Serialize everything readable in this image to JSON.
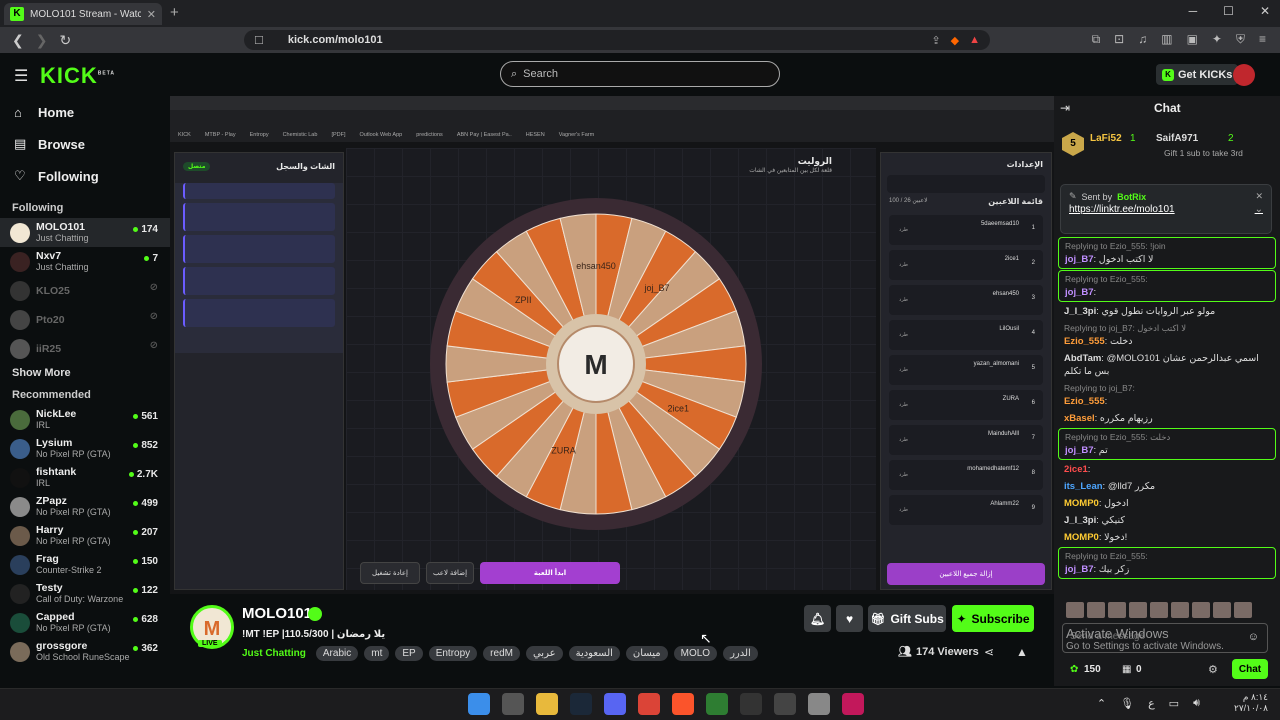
{
  "browser": {
    "tab_title": "MOLO101 Stream - Watch Li...",
    "tab_close": "✕",
    "new_tab": "+",
    "url": "kick.com/molo101"
  },
  "header": {
    "logo": "KICK",
    "logo_badge": "BETA",
    "search_placeholder": "Search",
    "get_kicks": "Get KICKs"
  },
  "sidebar": {
    "nav": [
      {
        "label": "Home",
        "icon": "home-icon"
      },
      {
        "label": "Browse",
        "icon": "browse-icon"
      },
      {
        "label": "Following",
        "icon": "heart-icon"
      }
    ],
    "following_title": "Following",
    "following": [
      {
        "name": "MOLO101",
        "category": "Just Chatting",
        "viewers": "174",
        "live": true,
        "avatar": "#f1e7d4"
      },
      {
        "name": "Nxv7",
        "category": "Just Chatting",
        "viewers": "7",
        "live": true,
        "avatar": "#3a2222"
      },
      {
        "name": "KLO25",
        "category": "",
        "viewers": "",
        "live": false,
        "avatar": "#333"
      },
      {
        "name": "Pto20",
        "category": "",
        "viewers": "",
        "live": false,
        "avatar": "#444"
      },
      {
        "name": "iiR25",
        "category": "",
        "viewers": "",
        "live": false,
        "avatar": "#555"
      }
    ],
    "show_more": "Show More",
    "recommended_title": "Recommended",
    "recommended": [
      {
        "name": "NickLee",
        "category": "IRL",
        "viewers": "561",
        "avatar": "#4a6b3c"
      },
      {
        "name": "Lysium",
        "category": "No Pixel RP (GTA)",
        "viewers": "852",
        "avatar": "#3a5d8a"
      },
      {
        "name": "fishtank",
        "category": "IRL",
        "viewers": "2.7K",
        "avatar": "#111"
      },
      {
        "name": "ZPapz",
        "category": "No Pixel RP (GTA)",
        "viewers": "499",
        "avatar": "#8a8a8a"
      },
      {
        "name": "Harry",
        "category": "No Pixel RP (GTA)",
        "viewers": "207",
        "avatar": "#6b5a4a"
      },
      {
        "name": "Frag",
        "category": "Counter-Strike 2",
        "viewers": "150",
        "avatar": "#2a3f5c"
      },
      {
        "name": "Testy",
        "category": "Call of Duty: Warzone",
        "viewers": "122",
        "avatar": "#222"
      },
      {
        "name": "Capped",
        "category": "No Pixel RP (GTA)",
        "viewers": "628",
        "avatar": "#1a4d3a"
      },
      {
        "name": "grossgore",
        "category": "Old School RuneScape",
        "viewers": "362",
        "avatar": "#7a6b5a"
      }
    ]
  },
  "stream": {
    "roulette_title": "الروليت",
    "roulette_subtitle": "قلعة لكل بين المتابعين في الشات",
    "settings_title": "الإعدادات",
    "chat_log_title": "الشات والسجل",
    "players_list_title": "قائمة اللاعبين",
    "players_count": "100 / 26 لاعبين",
    "players": [
      "5daeemsad10",
      "2ice1",
      "ehsan450",
      "LilOusil",
      "yazan_almomani",
      "ZURA",
      "MainduhAlll",
      "mohamedhatemf12",
      "Ahlamm22"
    ],
    "player_status": "طرد",
    "start_game": "ابدأ اللعبة",
    "add_player": "إضافة لاعب",
    "restart": "إعادة تشغيل",
    "remove_all": "إزالة جميع اللاعبين",
    "wheel_labels": [
      "joj_B7",
      "2ice1",
      "ZURA",
      "ZPII",
      "ehsan450"
    ]
  },
  "channel": {
    "name": "MOLO101",
    "live_label": "LIVE",
    "title": "!MT !EP |110.5/300 | يلا رمضان",
    "category": "Just Chatting",
    "tags": [
      "Arabic",
      "mt",
      "EP",
      "Entropy",
      "redM",
      "عربي",
      "السعودية",
      "ميسان",
      "MOLO",
      "الدرر"
    ],
    "gift_subs": "Gift Subs",
    "subscribe": "Subscribe",
    "viewers": "174 Viewers"
  },
  "chat": {
    "title": "Chat",
    "leaderboard": [
      {
        "name": "LaFi52",
        "count": "1",
        "rank": "5"
      },
      {
        "name": "SaifA971",
        "count": "2",
        "note": "Gift 1 sub to take 3rd"
      }
    ],
    "pinned_by": "Sent by",
    "pinned_user": "BotRix",
    "pinned_link": "https://linktr.ee/molo101",
    "messages": [
      {
        "reply": "Replying to Ezio_555: !join",
        "user": "joj_B7",
        "text": "لا اكتب ادخول",
        "color": "#c08fff",
        "hl": true
      },
      {
        "reply": "Replying to Ezio_555:",
        "user": "joj_B7",
        "text": "",
        "color": "#c08fff",
        "hl": true
      },
      {
        "reply": "",
        "user": "J_l_3pi",
        "text": "مولو عبر الروايات تطول قوي",
        "color": "#ddd",
        "hl": false
      },
      {
        "reply": "Replying to joj_B7: لا اكتب ادخول",
        "user": "Ezio_555",
        "text": "دخلت",
        "color": "#ff9d3a",
        "hl": false
      },
      {
        "reply": "",
        "user": "AbdTam",
        "text": "@MOLO101 اسمي عبدالرحمن عشان بس ما تكلم",
        "color": "#ddd",
        "hl": false
      },
      {
        "reply": "Replying to joj_B7:",
        "user": "Ezio_555",
        "text": "",
        "color": "#ff9d3a",
        "hl": false
      },
      {
        "reply": "",
        "user": "xBasel",
        "text": "رزيهام مكرره",
        "color": "#ff9d3a",
        "hl": false
      },
      {
        "reply": "Replying to Ezio_555: دخلت",
        "user": "joj_B7",
        "text": "تم",
        "color": "#c08fff",
        "hl": true
      },
      {
        "reply": "",
        "user": "2ice1",
        "text": "",
        "color": "#ff4d4d",
        "hl": false
      },
      {
        "reply": "",
        "user": "its_Lean",
        "text": "@lld7 مكرر",
        "color": "#4da6ff",
        "hl": false
      },
      {
        "reply": "",
        "user": "MOMP0",
        "text": "ادخول",
        "color": "#ffcc33",
        "hl": false
      },
      {
        "reply": "",
        "user": "J_l_3pi",
        "text": "كنيكي",
        "color": "#ddd",
        "hl": false
      },
      {
        "reply": "",
        "user": "MOMP0",
        "text": "دخولا!",
        "color": "#ffcc33",
        "hl": false
      },
      {
        "reply": "Replying to Ezio_555:",
        "user": "joj_B7",
        "text": "زكر بيك",
        "color": "#c08fff",
        "hl": true
      }
    ],
    "input_placeholder": "Send a message",
    "activate_title": "Activate Windows",
    "activate_sub": "Go to Settings to activate Windows.",
    "points": "150",
    "zero": "0",
    "chat_button": "Chat"
  },
  "taskbar": {
    "time": "٨:١٤ م",
    "date": "٢٧/١٠/٠٨"
  },
  "colors": {
    "accent": "#53fc18",
    "wheel_orange": "#d96a2b",
    "wheel_tan": "#c9a07e",
    "purple_btn": "#9b3fc8"
  }
}
